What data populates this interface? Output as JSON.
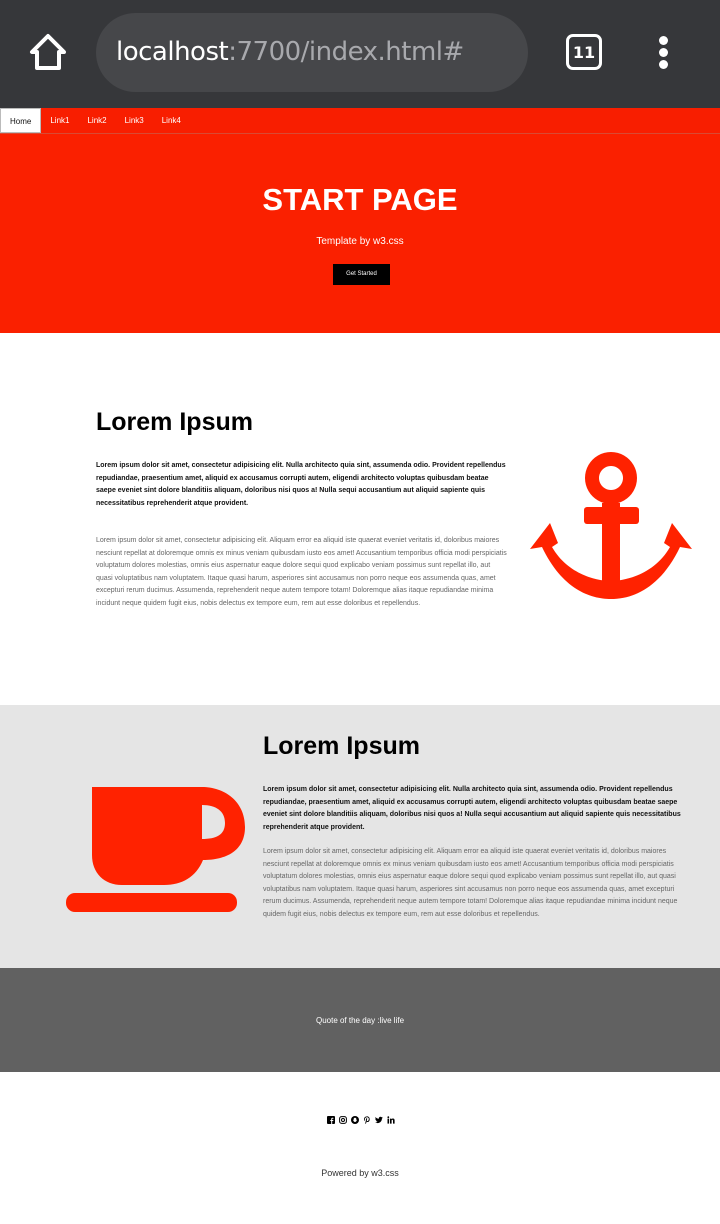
{
  "browser": {
    "url_host": "localhost",
    "url_rest": ":7700/index.html#",
    "tab_count": "11",
    "icons": [
      "home-icon",
      "tab-switcher-icon",
      "more-menu-icon"
    ]
  },
  "nav": {
    "items": [
      "Home",
      "Link1",
      "Link2",
      "Link3",
      "Link4"
    ],
    "active": "Home"
  },
  "header": {
    "title": "START PAGE",
    "subtitle": "Template by w3.css",
    "button": "Get Started"
  },
  "section1": {
    "heading": "Lorem Ipsum",
    "lead": "Lorem ipsum dolor sit amet, consectetur adipisicing elit. Nulla architecto quia sint, assumenda odio. Provident repellendus repudiandae, praesentium amet, aliquid ex accusamus corrupti autem, eligendi architecto voluptas quibusdam beatae saepe eveniet sint dolore blanditiis aliquam, doloribus nisi quos a! Nulla sequi accusantium aut aliquid sapiente quis necessitatibus reprehenderit atque provident.",
    "body": "Lorem ipsum dolor sit amet, consectetur adipisicing elit. Aliquam error ea aliquid iste quaerat eveniet veritatis id, doloribus maiores nesciunt repellat at doloremque omnis ex minus veniam quibusdam iusto eos amet! Accusantium temporibus officia modi perspiciatis voluptatum dolores molestias, omnis eius aspernatur eaque dolore sequi quod explicabo veniam possimus sunt repellat illo, aut quasi voluptatibus nam voluptatem. Itaque quasi harum, asperiores sint accusamus non porro neque eos assumenda quas, amet excepturi rerum ducimus. Assumenda, reprehenderit neque autem tempore totam! Doloremque alias itaque repudiandae minima incidunt neque quidem fugit eius, nobis delectus ex tempore eum, rem aut esse doloribus et repellendus.",
    "icon": "anchor-icon",
    "icon_color": "#ff2200"
  },
  "section2": {
    "heading": "Lorem Ipsum",
    "lead": "Lorem ipsum dolor sit amet, consectetur adipisicing elit. Nulla architecto quia sint, assumenda odio. Provident repellendus repudiandae, praesentium amet, aliquid ex accusamus corrupti autem, eligendi architecto voluptas quibusdam beatae saepe eveniet sint dolore blanditiis aliquam, doloribus nisi quos a! Nulla sequi accusantium aut aliquid sapiente quis necessitatibus reprehenderit atque provident.",
    "body": "Lorem ipsum dolor sit amet, consectetur adipisicing elit. Aliquam error ea aliquid iste quaerat eveniet veritatis id, doloribus maiores nesciunt repellat at doloremque omnis ex minus veniam quibusdam iusto eos amet! Accusantium temporibus officia modi perspiciatis voluptatum dolores molestias, omnis eius aspernatur eaque dolore sequi quod explicabo veniam possimus sunt repellat illo, aut quasi voluptatibus nam voluptatem. Itaque quasi harum, asperiores sint accusamus non porro neque eos assumenda quas, amet excepturi rerum ducimus. Assumenda, reprehenderit neque autem tempore totam! Doloremque alias itaque repudiandae minima incidunt neque quidem fugit eius, nobis delectus ex tempore eum, rem aut esse doloribus et repellendus.",
    "icon": "coffee-cup-icon",
    "icon_color": "#ff2200"
  },
  "quote": {
    "text": "Quote of the day :live life"
  },
  "footer": {
    "social_icons": [
      "facebook-icon",
      "instagram-icon",
      "snapchat-icon",
      "pinterest-icon",
      "twitter-icon",
      "linkedin-icon"
    ],
    "powered": "Powered by w3.css"
  },
  "colors": {
    "brand_red": "#fa2000",
    "quote_bg": "#616161",
    "section_grey": "#e5e5e5",
    "chrome_bg": "#36373a"
  }
}
